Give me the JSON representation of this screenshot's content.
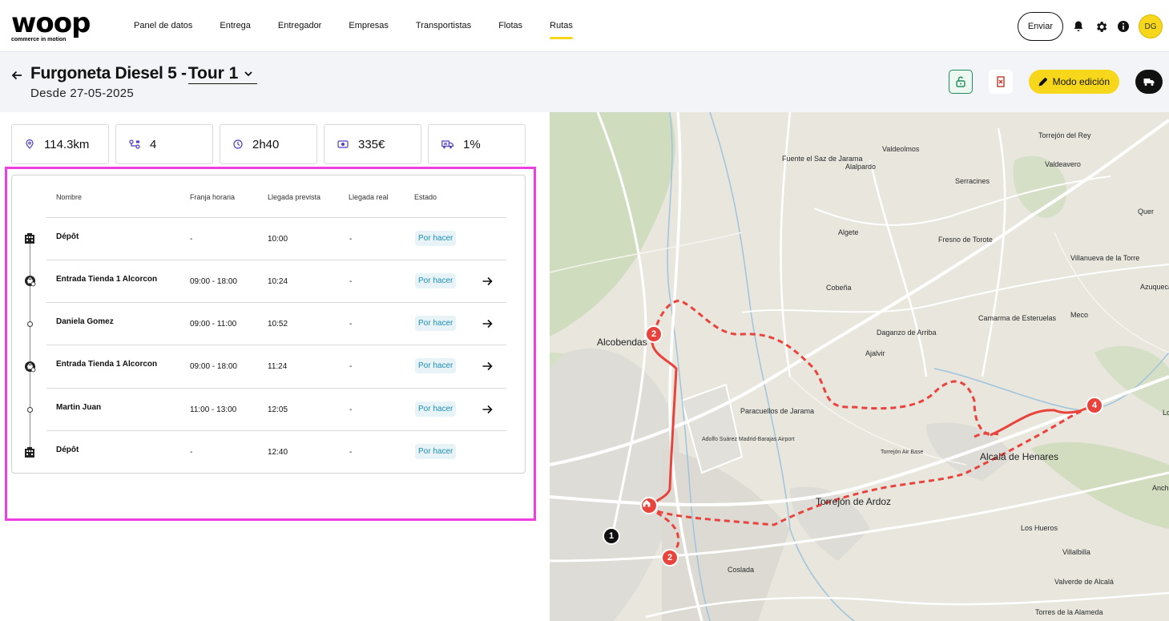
{
  "brand": {
    "name": "woop",
    "tagline": "commerce in motion"
  },
  "nav": {
    "items": [
      {
        "label": "Panel de datos",
        "active": false
      },
      {
        "label": "Entrega",
        "active": false
      },
      {
        "label": "Entregador",
        "active": false
      },
      {
        "label": "Empresas",
        "active": false
      },
      {
        "label": "Transportistas",
        "active": false
      },
      {
        "label": "Flotas",
        "active": false
      },
      {
        "label": "Rutas",
        "active": true
      }
    ],
    "send_label": "Enviar",
    "avatar_initials": "DG",
    "icons": [
      "bell-icon",
      "gear-icon",
      "info-icon"
    ]
  },
  "header": {
    "title": "Furgoneta Diesel 5 -",
    "tour": "Tour 1",
    "subtitle": "Desde 27-05-2025",
    "edit_label": "Modo edición"
  },
  "stats": [
    {
      "icon": "location-pin-icon",
      "value": "114.3km"
    },
    {
      "icon": "stops-icon",
      "value": "4"
    },
    {
      "icon": "clock-icon",
      "value": "2h40"
    },
    {
      "icon": "money-icon",
      "value": "335€"
    },
    {
      "icon": "truck-load-icon",
      "value": "1%"
    }
  ],
  "table": {
    "columns": [
      "Nombre",
      "Franja horaria",
      "Llegada prevista",
      "Llegada real",
      "Estado"
    ],
    "rows": [
      {
        "type": "depot",
        "name": "Dépôt",
        "window": "-",
        "eta": "10:00",
        "real": "-",
        "status": "Por hacer",
        "arrow": false
      },
      {
        "type": "store",
        "name": "Entrada Tienda 1 Alcorcon",
        "window": "09:00 - 18:00",
        "eta": "10:24",
        "real": "-",
        "status": "Por hacer",
        "arrow": true
      },
      {
        "type": "customer",
        "name": "Daniela Gomez",
        "window": "09:00 - 11:00",
        "eta": "10:52",
        "real": "-",
        "status": "Por hacer",
        "arrow": true
      },
      {
        "type": "store",
        "name": "Entrada Tienda 1 Alcorcon",
        "window": "09:00 - 18:00",
        "eta": "11:24",
        "real": "-",
        "status": "Por hacer",
        "arrow": true
      },
      {
        "type": "customer",
        "name": "Martin Juan",
        "window": "11:00 - 13:00",
        "eta": "12:05",
        "real": "-",
        "status": "Por hacer",
        "arrow": true
      },
      {
        "type": "depot",
        "name": "Dépôt",
        "window": "-",
        "eta": "12:40",
        "real": "-",
        "status": "Por hacer",
        "arrow": false
      }
    ]
  },
  "map": {
    "labels": [
      "Torrejón del Rey",
      "Valdeolmos",
      "Fuente el Saz de Jarama",
      "Alalpardo",
      "Valdeavero",
      "Serracines",
      "Quer",
      "Algete",
      "Fresno de Torote",
      "Villanueva de la Torre",
      "Azuqueca",
      "Cobeña",
      "Meco",
      "Camarma de Esteruelas",
      "Daganzo de Arriba",
      "Alcobendas",
      "Ajalvir",
      "Paracuellos de Jarama",
      "Adolfo Suárez Madrid-Barajas Airport",
      "Torrejón Air Base",
      "Alcalá de Henares",
      "Torrejón de Ardoz",
      "Los Hueros",
      "Villalbilla",
      "Coslada",
      "Valverde de Alcalá",
      "Torres de la Alameda",
      "Anch",
      "Lo"
    ],
    "markers": [
      "2",
      "2",
      "4",
      "1"
    ],
    "route_color": "#e8433c"
  },
  "colors": {
    "accent": "#f7d71c",
    "route": "#e8433c",
    "badge_bg": "#e7f3f7",
    "badge_text": "#1f8fb4",
    "highlight": "#ee3de0"
  }
}
